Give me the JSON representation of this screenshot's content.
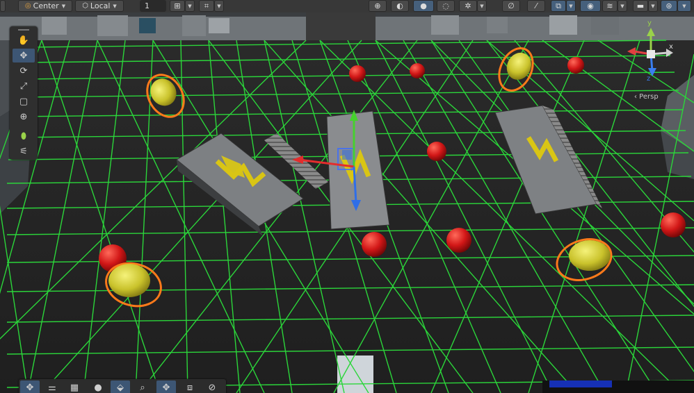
{
  "toolbar": {
    "pivot_label": "Center",
    "space_label": "Local",
    "snap_value": "1"
  },
  "gizmo": {
    "axis_y": "y",
    "axis_x": "x",
    "axis_z": "z",
    "projection_label": "‹ Persp"
  },
  "scene_tools": [
    "hand",
    "move",
    "rotate",
    "scale",
    "rect",
    "transform",
    "custom",
    "custom2"
  ],
  "colors": {
    "grid": "#2bd63a",
    "accent": "#46607c",
    "selection_outline": "#ff7a1a",
    "red_sphere": "#d21717"
  }
}
